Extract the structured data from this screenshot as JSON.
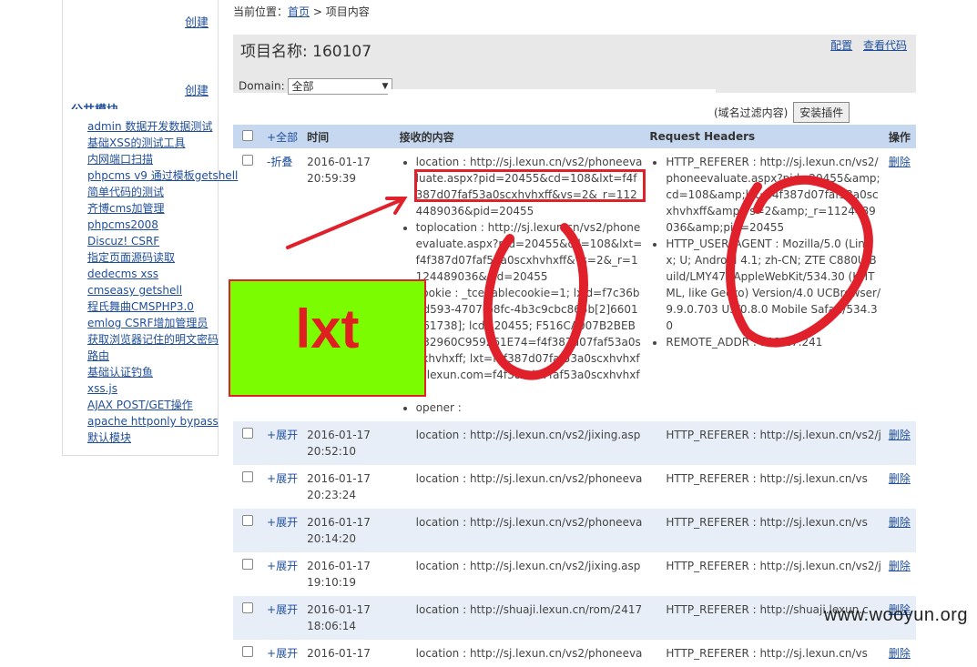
{
  "sidebar": {
    "create_1": "创建",
    "create_2": "创建",
    "heading": "公共模块",
    "links": [
      "admin 数据开发数据测试",
      "基础XSS的测试工具",
      "内网端口扫描",
      "phpcms v9 通过模板getshell",
      "简单代码的测试",
      "齐博cms加管理",
      "phpcms2008",
      "Discuz! CSRF",
      "指定页面源码读取",
      "dedecms xss",
      "cmseasy getshell",
      "程氏舞曲CMSPHP3.0",
      "emlog CSRF增加管理员",
      "获取浏览器记住的明文密码",
      "路由",
      "基础认证钓鱼",
      "xss.js",
      "AJAX POST/GET操作",
      "apache httponly bypass",
      "默认模块"
    ]
  },
  "breadcrumb": {
    "prefix": "当前位置：",
    "home": "首页",
    "sep": " > ",
    "current": "项目内容"
  },
  "project": {
    "title": "项目名称: 160107",
    "config": "配置",
    "view_code": "查看代码"
  },
  "domain": {
    "label": "Domain:",
    "selected": "全部"
  },
  "filter": {
    "hint": "(域名过滤内容)",
    "install_button": "安装插件"
  },
  "table": {
    "headers": {
      "all": "+全部",
      "time": "时间",
      "content": "接收的内容",
      "request_headers": "Request Headers",
      "actions": "操作"
    },
    "expanded": {
      "toggle": "-折叠",
      "date": "2016-01-17",
      "time": "20:59:39",
      "content": [
        "location : http://sj.lexun.cn/vs2/phoneevaluate.aspx?pid=20455&cd=108&lxt=f4f387d07faf53a0scxhvhxff&vs=2&_r=1124489036&pid=20455",
        "toplocation : http://sj.lexun.cn/vs2/phoneevaluate.aspx?pid=20455&cd=108&lxt=f4f387d07faf53a0scxhvhxff&vs=2&_r=1124489036&pid=20455",
        "cookie : _tcenablecookie=1; lxid=f7c36bf-d593-4707-b8fc-4b3c9cbc865b[2]6601161738]; lcd=20455; F516CA007B2BEB732960C959261E74=f4f387d07faf53a0scxhvhxff; lxt=f4f387d07faf53a0scxhvhxff; lexun.com=f4f387d07faf53a0scxhvhxff",
        "opener :"
      ],
      "headers": [
        "HTTP_REFERER : http://sj.lexun.cn/vs2/phoneevaluate.aspx?pid=20455&amp;cd=108&amp;lxt=f4f387d07faf53a0scxhvhxff&amp;vs=2&amp;_r=1124489036&amp;pid=20455",
        "HTTP_USER_AGENT : Mozilla/5.0 (Linux; U; Android 4.1; zh-CN; ZTE C880U Build/LMY47) AppleWebKit/534.30 (KHTML, like Gecko) Version/4.0 UCBrowser/9.9.0.703 U3/0.8.0 Mobile Safari/534.30",
        "REMOTE_ADDR : 112.17.241"
      ],
      "delete": "删除"
    },
    "rows": [
      {
        "toggle": "+展开",
        "date": "2016-01-17",
        "time": "20:52:10",
        "content": "location : http://sj.lexun.cn/vs2/jixing.asp",
        "header": "HTTP_REFERER : http://sj.lexun.cn/vs2/j",
        "delete": "删除"
      },
      {
        "toggle": "+展开",
        "date": "2016-01-17",
        "time": "20:23:24",
        "content": "location : http://sj.lexun.cn/vs2/phoneeva",
        "header": "HTTP_REFERER : http://sj.lexun.cn/vs",
        "delete": "删除"
      },
      {
        "toggle": "+展开",
        "date": "2016-01-17",
        "time": "20:14:20",
        "content": "location : http://sj.lexun.cn/vs2/phoneeva",
        "header": "HTTP_REFERER : http://sj.lexun.cn/vs",
        "delete": "删除"
      },
      {
        "toggle": "+展开",
        "date": "2016-01-17",
        "time": "19:10:19",
        "content": "location : http://sj.lexun.cn/vs2/jixing.asp",
        "header": "HTTP_REFERER : http://sj.lexun.cn/vs2/j",
        "delete": "删除"
      },
      {
        "toggle": "+展开",
        "date": "2016-01-17",
        "time": "18:06:14",
        "content": "location : http://shuaji.lexun.cn/rom/2417",
        "header": "HTTP_REFERER : http://shuaji.lexun.c",
        "delete": "删除"
      },
      {
        "toggle": "+展开",
        "date": "2016-01-17",
        "time": "",
        "content": "location : http://sj.lexun.cn/vs2/phoneeva",
        "header": "HTTP_REFERER : http://sj.lexun.cn/vs",
        "delete": "删除"
      }
    ]
  },
  "annotation": {
    "label": "lxt",
    "box_color": "#7cfc00",
    "mark_color": "#e0202a"
  },
  "watermark": "www.wooyun.org"
}
